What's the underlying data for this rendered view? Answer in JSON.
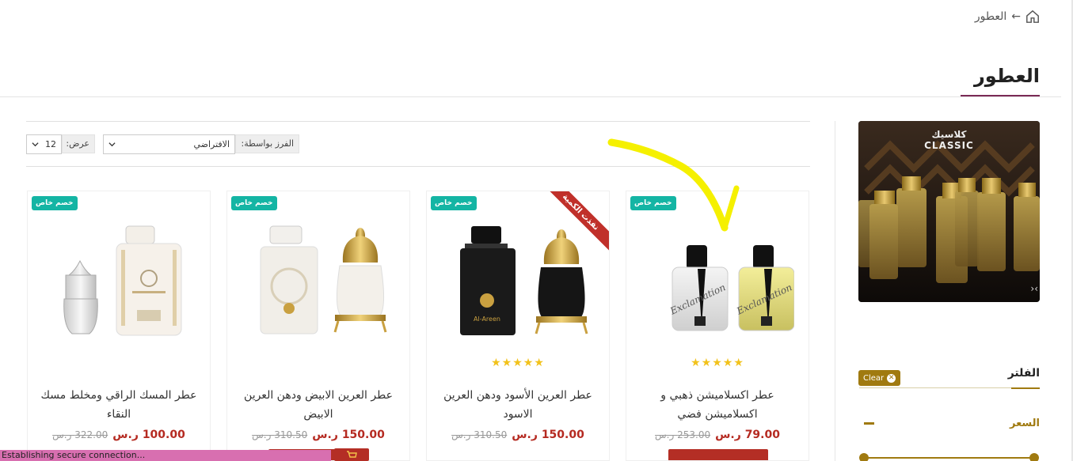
{
  "breadcrumb": {
    "current": "العطور",
    "arrow": "←"
  },
  "page_title": "العطور",
  "toolbar": {
    "sort_label": "الفرز بواسطة:",
    "sort_value": "الافتراضي",
    "show_label": "عرض:",
    "show_value": "12"
  },
  "banner": {
    "line1": "كلاسيك",
    "line2": "CLASSIC",
    "arrows": "›‹"
  },
  "filter": {
    "title": "الفلتر",
    "clear_label": "Clear",
    "clear_icon": "✕",
    "price_label": "السعر"
  },
  "products": [
    {
      "badge": "خصم خاص",
      "name": "عطر اكسلاميشن ذهبي و اكسلاميشن فضي",
      "price_new": "79.00 ر.س",
      "price_old": "253.00 ر.س",
      "stars": "★★★★★",
      "ribbon": ""
    },
    {
      "badge": "خصم خاص",
      "name": "عطر العرين الأسود ودهن العرين الاسود",
      "price_new": "150.00 ر.س",
      "price_old": "310.50 ر.س",
      "stars": "★★★★★",
      "ribbon": "نفذت الكمية"
    },
    {
      "badge": "خصم خاص",
      "name": "عطر العرين الابيض ودهن العرين الابيض",
      "price_new": "150.00 ر.س",
      "price_old": "310.50 ر.س",
      "stars": "",
      "ribbon": ""
    },
    {
      "badge": "خصم خاص",
      "name": "عطر المسك الراقي ومخلط مسك النقاء",
      "price_new": "100.00 ر.س",
      "price_old": "322.00 ر.س",
      "stars": "",
      "ribbon": ""
    }
  ],
  "status_bar": "Establishing secure connection...",
  "colors": {
    "accent": "#a07a10",
    "badge": "#14b5a4",
    "price": "#b52a21",
    "brand": "#7a2a55"
  }
}
